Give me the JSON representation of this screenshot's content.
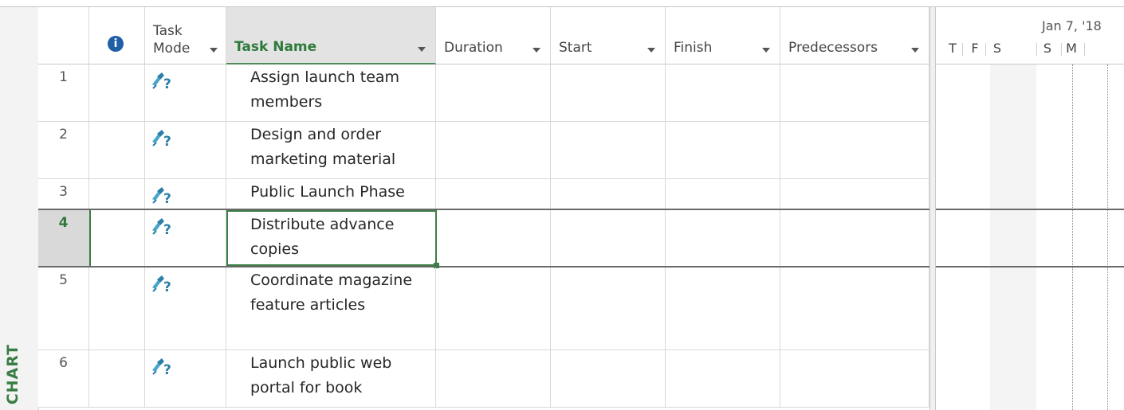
{
  "sidebar": {
    "label": "T CHART"
  },
  "columns": {
    "task_mode": "Task\nMode",
    "task_name": "Task Name",
    "duration": "Duration",
    "start": "Start",
    "finish": "Finish",
    "predecessors": "Predecessors"
  },
  "info_icon": "i",
  "tasks": [
    {
      "id": "1",
      "name": "Assign launch team members",
      "mode": "manually-scheduled-icon"
    },
    {
      "id": "2",
      "name": "Design and order marketing material",
      "mode": "manually-scheduled-icon"
    },
    {
      "id": "3",
      "name": "Public Launch Phase",
      "mode": "manually-scheduled-icon"
    },
    {
      "id": "4",
      "name": "Distribute advance copies",
      "mode": "manually-scheduled-icon",
      "selected": true
    },
    {
      "id": "5",
      "name": "Coordinate magazine feature articles",
      "mode": "manually-scheduled-icon"
    },
    {
      "id": "6",
      "name": "Launch public web portal for book",
      "mode": "manually-scheduled-icon"
    }
  ],
  "gantt": {
    "date_label": "Jan 7, '18",
    "days": [
      "T",
      "F",
      "S",
      "S",
      "M"
    ]
  },
  "colors": {
    "accent": "#2f7a3b",
    "selection": "#3d7d47",
    "info_icon": "#1f5fa8"
  }
}
